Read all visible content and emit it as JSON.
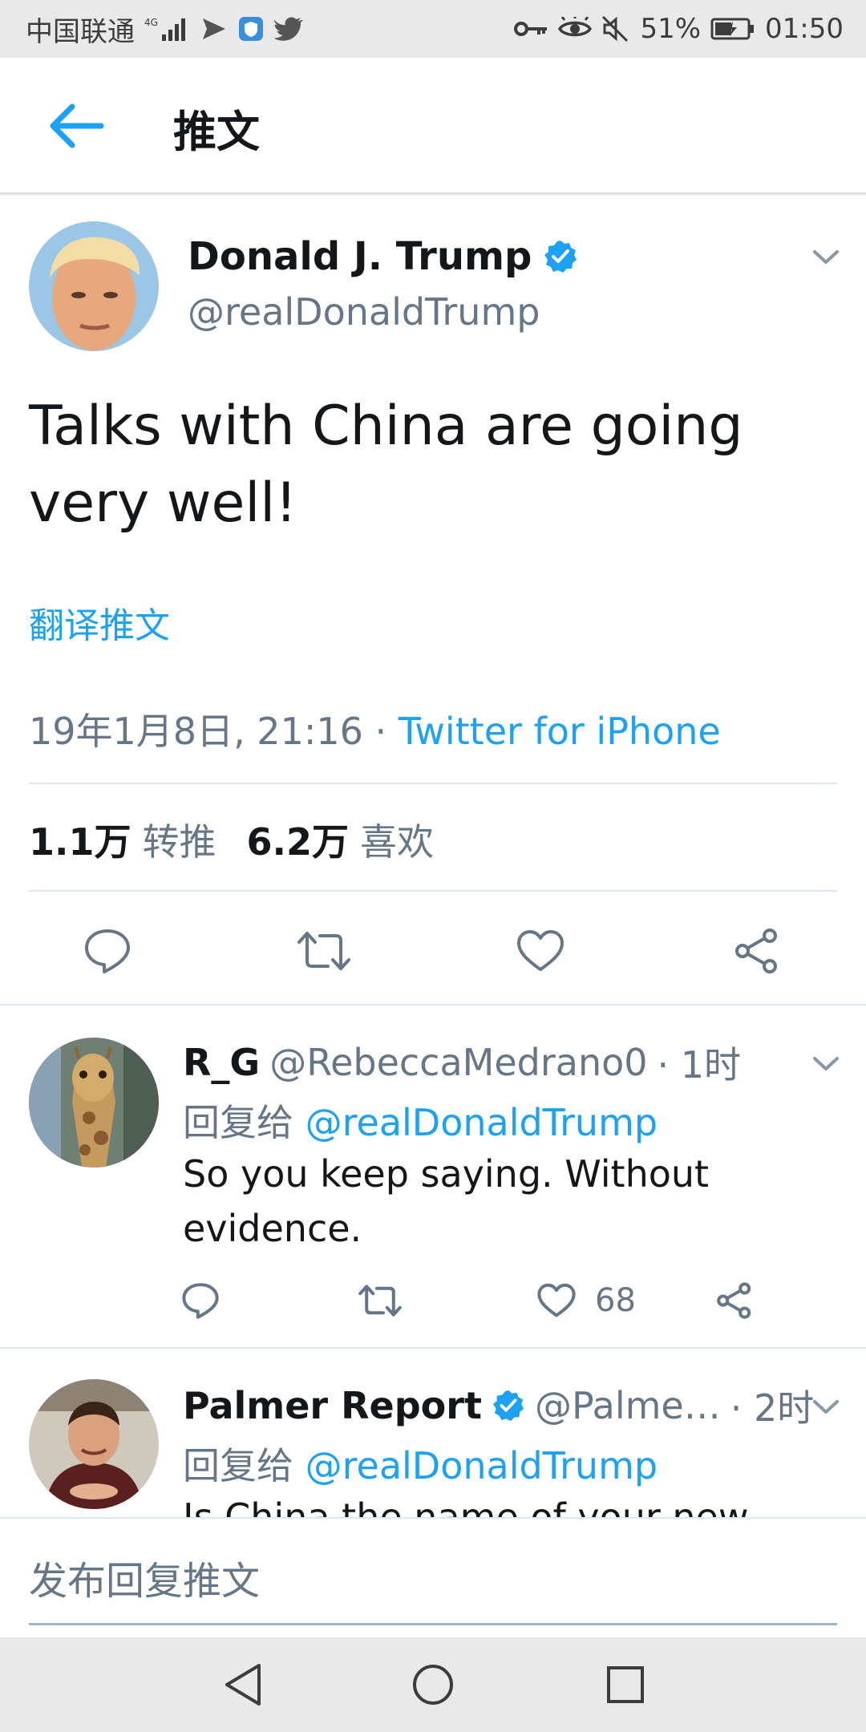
{
  "status_bar": {
    "carrier": "中国联通",
    "signal": "4G",
    "battery": "51%",
    "time": "01:50"
  },
  "header": {
    "title": "推文"
  },
  "main_tweet": {
    "name": "Donald J. Trump",
    "handle": "@realDonaldTrump",
    "text": "Talks with China are going very well!",
    "translate_label": "翻译推文",
    "datetime": "19年1月8日, 21:16",
    "separator": " · ",
    "source": "Twitter for iPhone",
    "retweets_count": "1.1万",
    "retweets_label": "转推",
    "likes_count": "6.2万",
    "likes_label": "喜欢"
  },
  "replies": [
    {
      "name": "R_G",
      "handle": "@RebeccaMedrano0",
      "time": "· 1时",
      "reply_prefix": "回复给",
      "reply_to": "@realDonaldTrump",
      "text": "So you keep saying. Without evidence.",
      "likes": "68"
    },
    {
      "name": "Palmer Report",
      "handle": "@Palme…",
      "time": "· 2时",
      "reply_prefix": "回复给",
      "reply_to": "@realDonaldTrump",
      "text": "Is China the name of your new"
    }
  ],
  "composer": {
    "placeholder": "发布回复推文"
  },
  "colors": {
    "accent": "#1da1f2",
    "secondary_text": "#657786",
    "primary_text": "#14171a"
  }
}
